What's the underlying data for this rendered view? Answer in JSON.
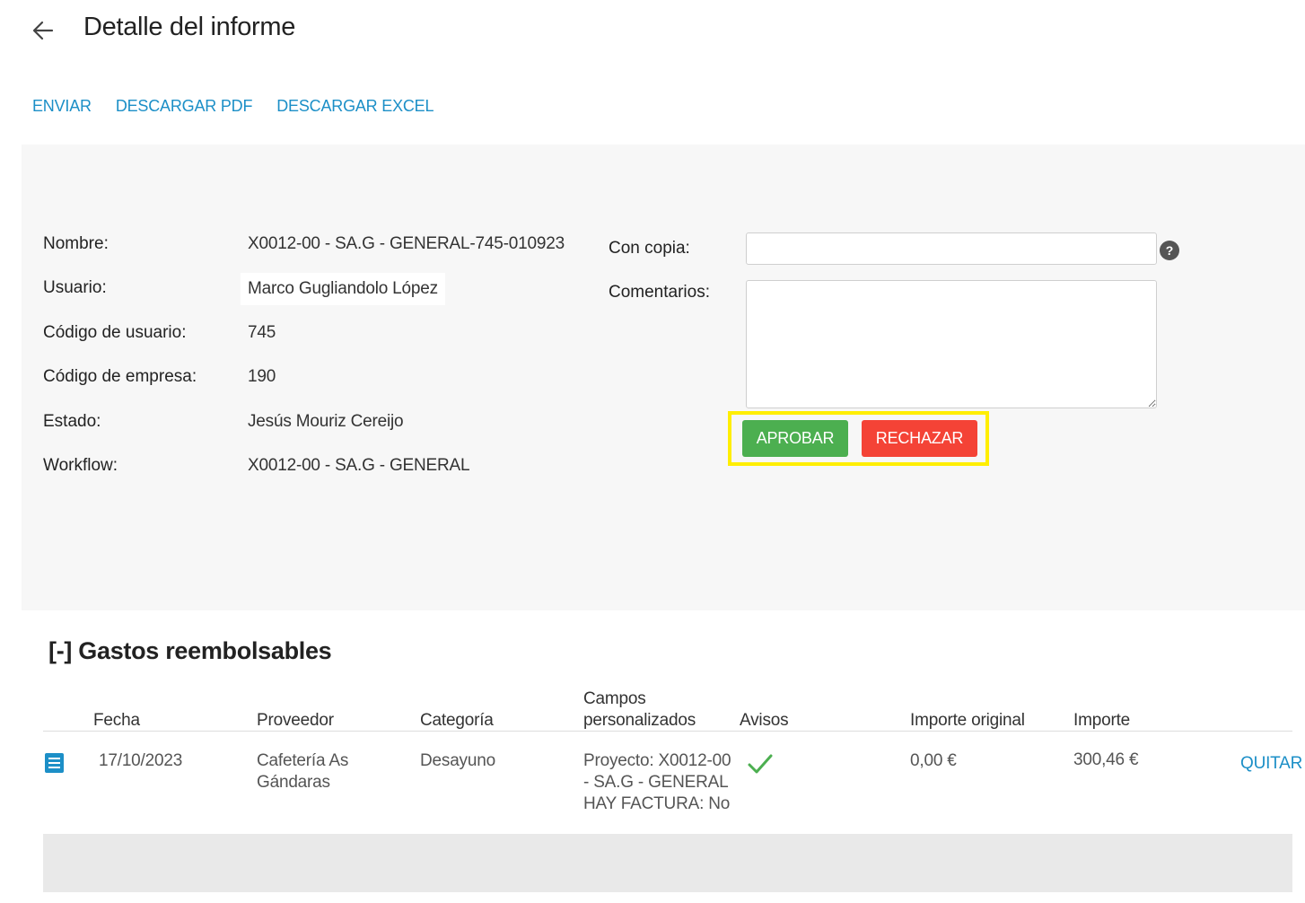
{
  "header": {
    "title": "Detalle del informe",
    "back_icon": "arrow-left-icon"
  },
  "actions": [
    {
      "label": "ENVIAR"
    },
    {
      "label": "DESCARGAR PDF"
    },
    {
      "label": "DESCARGAR EXCEL"
    }
  ],
  "report": {
    "nombre_label": "Nombre:",
    "nombre_value": "X0012-00 - SA.G - GENERAL-745-010923",
    "usuario_label": "Usuario:",
    "usuario_value": "Marco Gugliandolo López",
    "codigo_usuario_label": "Código de usuario:",
    "codigo_usuario_value": "745",
    "codigo_empresa_label": "Código de empresa:",
    "codigo_empresa_value": "190",
    "estado_label": "Estado:",
    "estado_value": "Jesús Mouriz Cereijo",
    "workflow_label": "Workflow:",
    "workflow_value": "X0012-00 - SA.G - GENERAL"
  },
  "form": {
    "cc_label": "Con copia:",
    "cc_value": "",
    "comments_label": "Comentarios:",
    "comments_value": "",
    "help_symbol": "?",
    "approve_label": "APROBAR",
    "reject_label": "RECHAZAR"
  },
  "expenses": {
    "section_title": "[-] Gastos reembolsables",
    "columns": {
      "fecha": "Fecha",
      "proveedor": "Proveedor",
      "categoria": "Categoría",
      "campos_line1": "Campos",
      "campos_line2": "personalizados",
      "avisos": "Avisos",
      "importe_original": "Importe original",
      "importe": "Importe"
    },
    "rows": [
      {
        "fecha": "17/10/2023",
        "proveedor_line1": "Cafetería As",
        "proveedor_line2": "Gándaras",
        "categoria": "Desayuno",
        "campos_line1": "Proyecto: X0012-00",
        "campos_line2": "- SA.G - GENERAL",
        "campos_line3": "HAY FACTURA: No",
        "avisos_icon": "checkmark-icon",
        "importe_original": "0,00 €",
        "importe": "300,46 €",
        "remove_label": "QUITAR"
      }
    ]
  },
  "colors": {
    "link": "#1c8fc7",
    "approve": "#4caf50",
    "reject": "#f44336",
    "highlight": "#ffee00",
    "panel_bg": "#f7f7f7"
  }
}
